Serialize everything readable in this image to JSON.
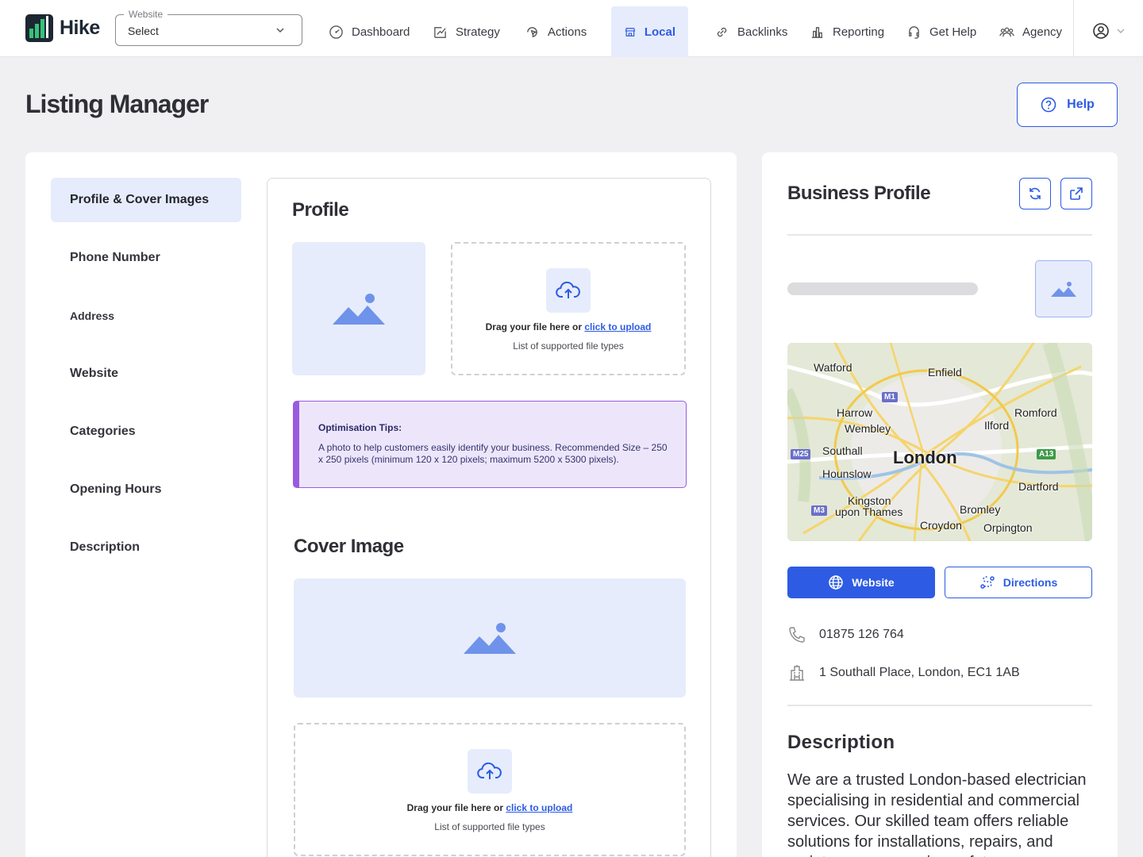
{
  "app": {
    "name": "Hike"
  },
  "website_select": {
    "legend": "Website",
    "value": "Select"
  },
  "nav": {
    "items": [
      {
        "label": "Dashboard",
        "icon": "gauge-icon"
      },
      {
        "label": "Strategy",
        "icon": "strategy-icon"
      },
      {
        "label": "Actions",
        "icon": "actions-icon"
      },
      {
        "label": "Local",
        "icon": "store-icon",
        "active": true
      },
      {
        "label": "Backlinks",
        "icon": "link-icon"
      },
      {
        "label": "Reporting",
        "icon": "bar-chart-icon"
      },
      {
        "label": "Get Help",
        "icon": "headset-icon"
      },
      {
        "label": "Agency",
        "icon": "users-icon"
      }
    ]
  },
  "page": {
    "title": "Listing Manager",
    "help_label": "Help"
  },
  "sidebar": {
    "items": [
      {
        "label": "Profile & Cover Images",
        "active": true
      },
      {
        "label": "Phone Number"
      },
      {
        "label": "Address"
      },
      {
        "label": "Website"
      },
      {
        "label": "Categories"
      },
      {
        "label": "Opening Hours"
      },
      {
        "label": "Description"
      }
    ]
  },
  "profile": {
    "title": "Profile",
    "upload": {
      "prompt": "Drag your file here or ",
      "link": "click to upload",
      "hint": "List of supported file types"
    },
    "tips": {
      "title": "Optimisation Tips:",
      "body": "A photo to help customers easily identify your business. Recommended Size – 250 x 250 pixels (minimum 120 x 120 pixels; maximum 5200 x 5300 pixels)."
    }
  },
  "cover": {
    "title": "Cover Image",
    "upload": {
      "prompt": "Drag your file here or ",
      "link": "click to upload",
      "hint": "List of supported file types"
    }
  },
  "business_profile": {
    "title": "Business Profile",
    "map": {
      "labels": [
        "Watford",
        "Enfield",
        "Harrow",
        "Wembley",
        "Romford",
        "Ilford",
        "Southall",
        "London",
        "Hounslow",
        "Dartford",
        "Kingston",
        "upon Thames",
        "Bromley",
        "Croydon",
        "Orpington"
      ],
      "shields": [
        "M1",
        "M25",
        "A13",
        "M3"
      ]
    },
    "website_label": "Website",
    "directions_label": "Directions",
    "phone": "01875 126 764",
    "address": "1 Southall Place, London, EC1 1AB",
    "description_title": "Description",
    "description": "We are a trusted London-based electrician specialising in residential and commercial services. Our skilled team offers reliable solutions for installations, repairs, and maintenance, ensuring safety"
  },
  "colors": {
    "accent": "#2d5be3",
    "accent_light": "#e6ecfb",
    "tips_border": "#9a5ae0",
    "tips_bg": "#ede6fb",
    "brand_dark": "#1d2733",
    "brand_green": "#35c27a"
  }
}
